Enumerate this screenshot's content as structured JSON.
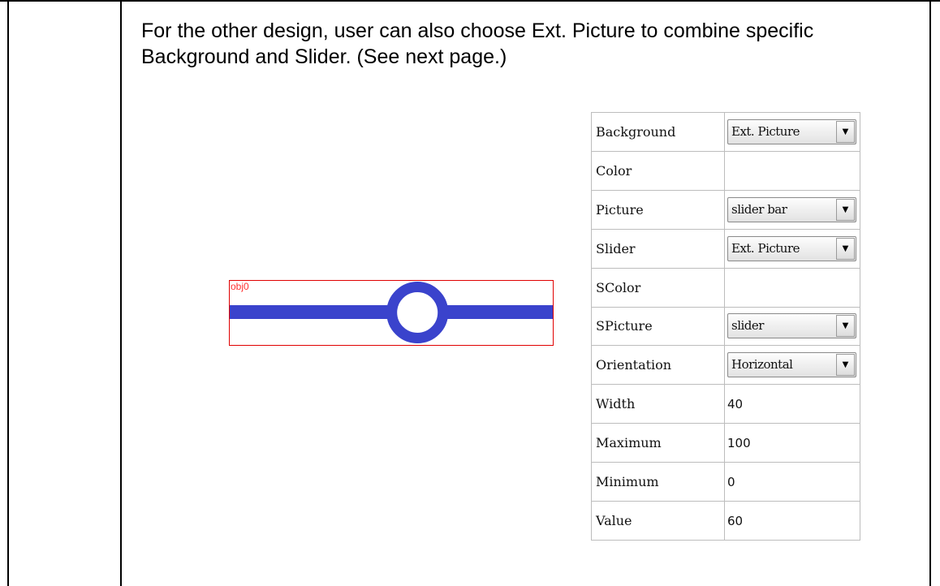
{
  "description": "For the other design, user can also choose Ext. Picture to combine specific Background and Slider. (See next page.)",
  "preview": {
    "object_label": "obj0",
    "slider_value_fraction": 0.6,
    "colors": {
      "frame": "#e00000",
      "label": "#ff3030",
      "bar": "#3a43cc"
    }
  },
  "properties": [
    {
      "name": "Background",
      "value": "Ext. Picture",
      "kind": "dropdown"
    },
    {
      "name": "Color",
      "value": "",
      "kind": "text"
    },
    {
      "name": "Picture",
      "value": "slider bar",
      "kind": "dropdown"
    },
    {
      "name": "Slider",
      "value": "Ext. Picture",
      "kind": "dropdown"
    },
    {
      "name": "SColor",
      "value": "",
      "kind": "text"
    },
    {
      "name": "SPicture",
      "value": "slider",
      "kind": "dropdown"
    },
    {
      "name": "Orientation",
      "value": "Horizontal",
      "kind": "dropdown"
    },
    {
      "name": "Width",
      "value": "40",
      "kind": "text"
    },
    {
      "name": "Maximum",
      "value": "100",
      "kind": "text"
    },
    {
      "name": "Minimum",
      "value": "0",
      "kind": "text"
    },
    {
      "name": "Value",
      "value": "60",
      "kind": "text"
    }
  ],
  "icons": {
    "dropdown_arrow": "chevron-down-icon"
  }
}
